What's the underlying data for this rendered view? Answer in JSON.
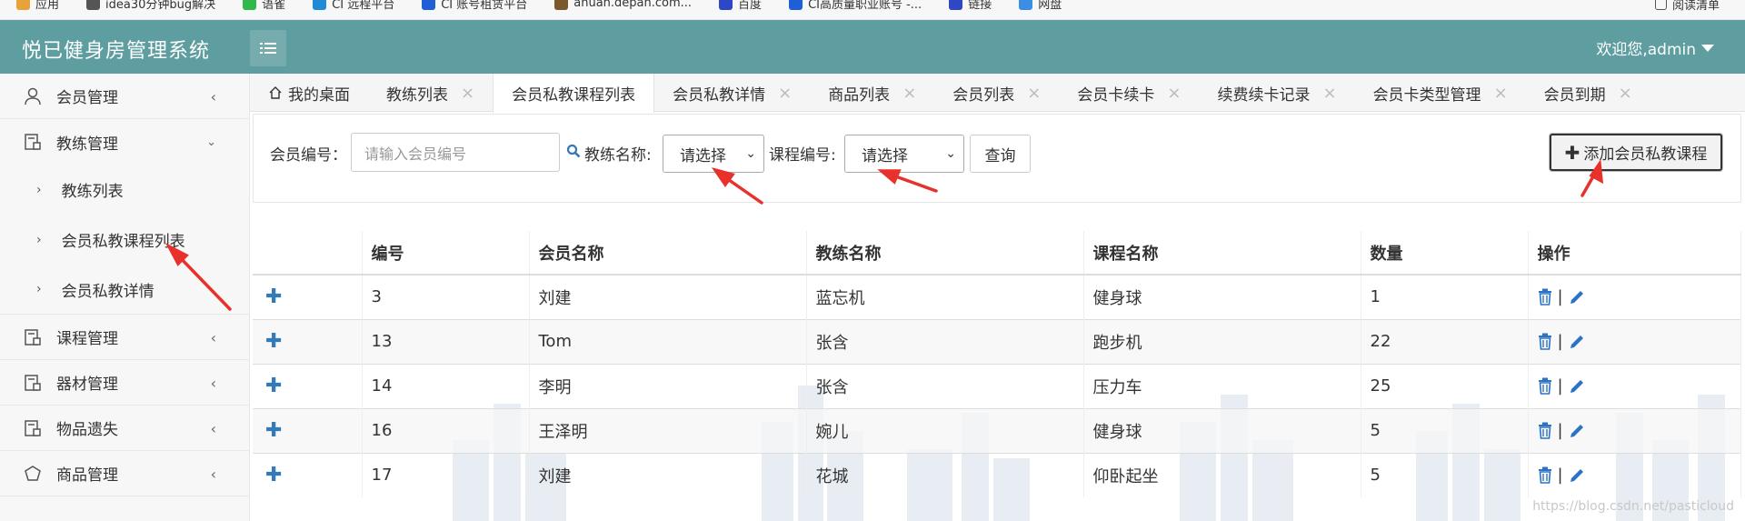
{
  "bookmarks": [
    {
      "label": "应用",
      "color": "#e8a23a"
    },
    {
      "label": "idea30分钟bug解决",
      "color": "#555555"
    },
    {
      "label": "语雀",
      "color": "#31b84a"
    },
    {
      "label": "CI 远程平台",
      "color": "#1f8ad6"
    },
    {
      "label": "CI 账号租赁平台",
      "color": "#1f5fd6"
    },
    {
      "label": "anuan.depan.com...",
      "color": "#7a5a2a"
    },
    {
      "label": "百度",
      "color": "#2d47c5"
    },
    {
      "label": "CI高质量职业账号 -...",
      "color": "#1f5fd6"
    },
    {
      "label": "链接",
      "color": "#2d47c5"
    },
    {
      "label": "网盘",
      "color": "#3a8ee6"
    }
  ],
  "reading_list": "阅读清单",
  "header": {
    "brand": "悦已健身房管理系统",
    "welcome": "欢迎您,admin",
    "bg_color": "#5f9ea0"
  },
  "sidebar": {
    "items": [
      {
        "label": "会员管理",
        "icon": "user-icon",
        "arrow": "<"
      },
      {
        "label": "教练管理",
        "icon": "document-icon",
        "arrow": "v"
      },
      {
        "label": "课程管理",
        "icon": "document-icon",
        "arrow": "<"
      },
      {
        "label": "器材管理",
        "icon": "document-icon",
        "arrow": "<"
      },
      {
        "label": "物品遗失",
        "icon": "document-icon",
        "arrow": "<"
      },
      {
        "label": "商品管理",
        "icon": "box-icon",
        "arrow": "<"
      }
    ],
    "subitems": [
      "教练列表",
      "会员私教课程列表",
      "会员私教详情"
    ]
  },
  "tabs": [
    {
      "label": "我的桌面",
      "closable": false
    },
    {
      "label": "教练列表",
      "closable": true
    },
    {
      "label": "会员私教课程列表",
      "closable": false,
      "active": true
    },
    {
      "label": "会员私教详情",
      "closable": true
    },
    {
      "label": "商品列表",
      "closable": true
    },
    {
      "label": "会员列表",
      "closable": true
    },
    {
      "label": "会员卡续卡",
      "closable": true
    },
    {
      "label": "续费续卡记录",
      "closable": true
    },
    {
      "label": "会员卡类型管理",
      "closable": true
    },
    {
      "label": "会员到期",
      "closable": true
    }
  ],
  "filters": {
    "member_id_label": "会员编号：",
    "member_id_placeholder": "请输入会员编号",
    "coach_label": "教练名称:",
    "coach_value": "请选择",
    "course_label": "课程编号:",
    "course_value": "请选择",
    "query_button": "查询",
    "add_button": "添加会员私教课程"
  },
  "table": {
    "columns": [
      "",
      "编号",
      "会员名称",
      "教练名称",
      "课程名称",
      "数量",
      "操作"
    ],
    "rows": [
      {
        "id": "3",
        "member": "刘建",
        "coach": "蓝忘机",
        "course": "健身球",
        "qty": "1"
      },
      {
        "id": "13",
        "member": "Tom",
        "coach": "张含",
        "course": "跑步机",
        "qty": "22"
      },
      {
        "id": "14",
        "member": "李明",
        "coach": "张含",
        "course": "压力车",
        "qty": "25"
      },
      {
        "id": "16",
        "member": "王泽明",
        "coach": "婉儿",
        "course": "健身球",
        "qty": "5"
      },
      {
        "id": "17",
        "member": "刘建",
        "coach": "花城",
        "course": "仰卧起坐",
        "qty": "5"
      }
    ],
    "op_separator": "|"
  },
  "watermark": "https://blog.csdn.net/pasticloud"
}
